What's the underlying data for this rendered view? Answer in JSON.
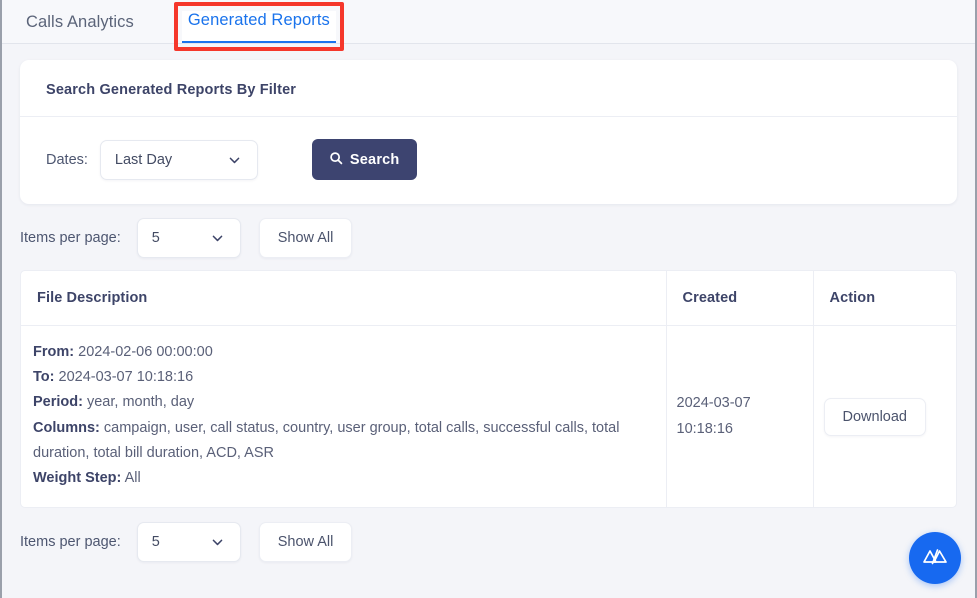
{
  "tabs": [
    {
      "label": "Calls Analytics",
      "active": false
    },
    {
      "label": "Generated Reports",
      "active": true
    }
  ],
  "filter_card": {
    "title": "Search Generated Reports By Filter",
    "dates_label": "Dates:",
    "dates_value": "Last Day",
    "search_label": "Search",
    "search_icon": "search-icon",
    "chevron_icon": "chevron-down-icon",
    "accent_color": "#3d4470"
  },
  "pager_top": {
    "label": "Items per page:",
    "value": "5",
    "show_all_label": "Show All"
  },
  "pager_bottom": {
    "label": "Items per page:",
    "value": "5",
    "show_all_label": "Show All"
  },
  "table": {
    "headers": [
      "File Description",
      "Created",
      "Action"
    ],
    "rows": [
      {
        "from_label": "From:",
        "from_value": "2024-02-06 00:00:00",
        "to_label": "To:",
        "to_value": "2024-03-07 10:18:16",
        "period_label": "Period:",
        "period_value": "year, month, day",
        "columns_label": "Columns:",
        "columns_value": "campaign, user, call status, country, user group, total calls, successful calls, total duration, total bill duration, ACD, ASR",
        "weight_label": "Weight Step:",
        "weight_value": "All",
        "created": "2024-03-07 10:18:16",
        "action_label": "Download"
      }
    ]
  },
  "fab": {
    "icon": "mountain-logo-icon",
    "color": "#1769f0"
  },
  "annotation": {
    "highlight_color": "#f5372b",
    "target": "Generated Reports"
  }
}
